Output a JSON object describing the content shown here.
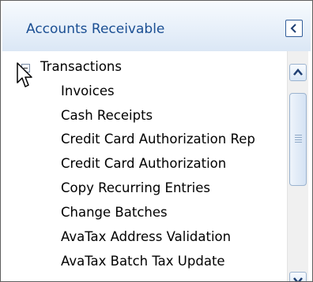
{
  "header": {
    "title": "Accounts Receivable"
  },
  "tree": {
    "root": {
      "label": "Transactions"
    },
    "items": [
      {
        "label": "Invoices"
      },
      {
        "label": "Cash Receipts"
      },
      {
        "label": "Credit Card Authorization Rep"
      },
      {
        "label": "Credit Card Authorization"
      },
      {
        "label": "Copy Recurring Entries"
      },
      {
        "label": "Change Batches"
      },
      {
        "label": "AvaTax Address Validation"
      },
      {
        "label": "AvaTax Batch Tax Update"
      }
    ]
  },
  "icons": {
    "collapse": "chevron-left-icon",
    "expander": "minus-box-icon",
    "scroll_up": "chevron-up-icon",
    "scroll_down": "chevron-down-icon",
    "cursor": "mouse-pointer-icon"
  },
  "colors": {
    "title": "#1b4f93",
    "header_top": "#f6fafe",
    "header_bottom": "#dbe7f5",
    "border": "#5f5f5f"
  }
}
